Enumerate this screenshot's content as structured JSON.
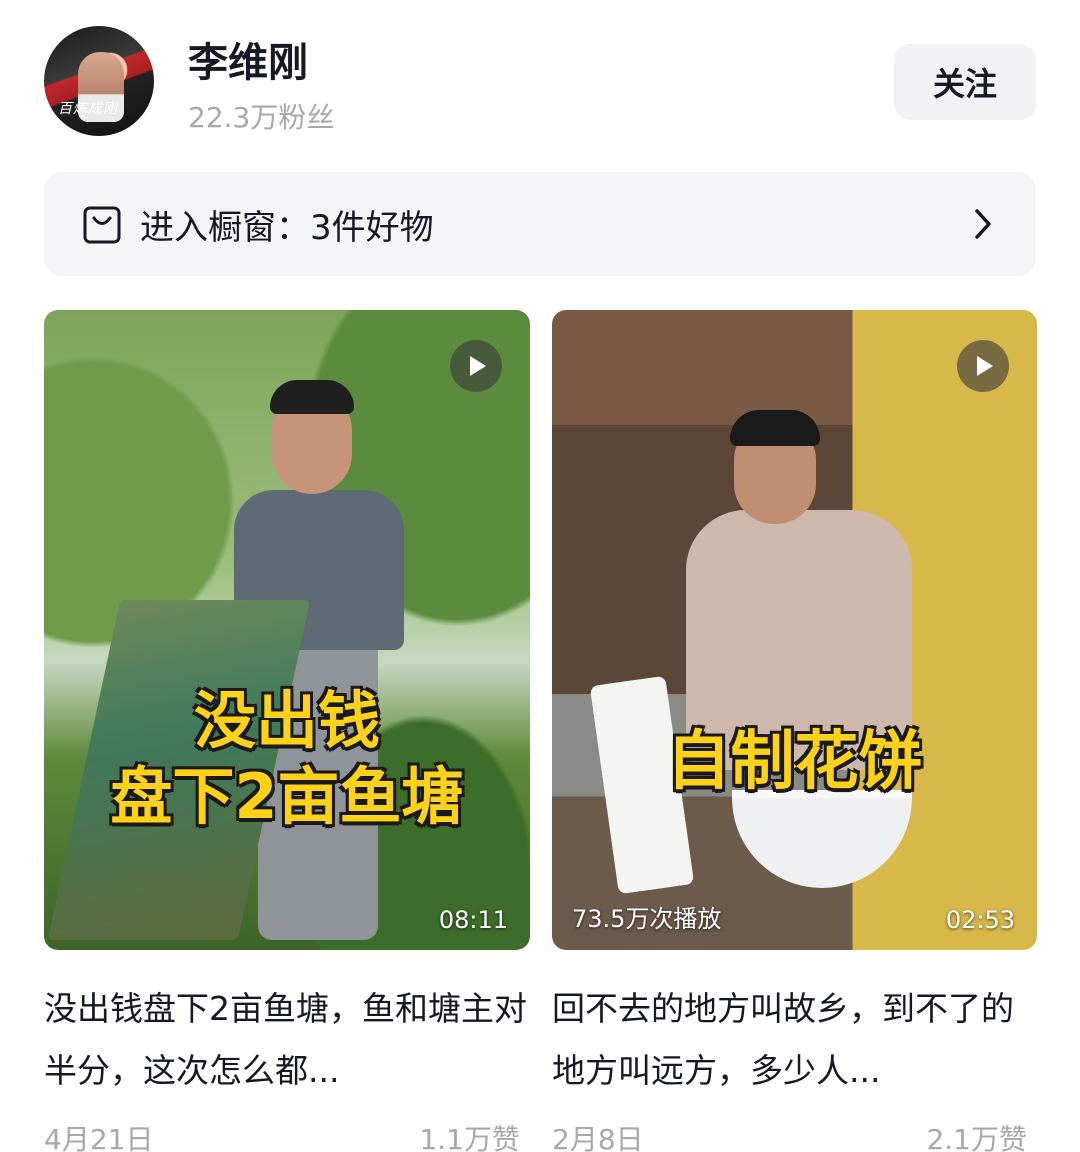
{
  "profile": {
    "name": "李维刚",
    "fans": "22.3万粉丝",
    "avatar_text": "百炼成刚",
    "follow_label": "关注"
  },
  "shop": {
    "label": "进入橱窗：3件好物",
    "icon": "shopping-bag-icon",
    "arrow_icon": "chevron-right-icon"
  },
  "videos": [
    {
      "overlay_line1": "没出钱",
      "overlay_line2": "盘下2亩鱼塘",
      "duration": "08:11",
      "plays": "",
      "caption": "没出钱盘下2亩鱼塘，鱼和塘主对半分，这次怎么都...",
      "date": "4月21日",
      "likes": "1.1万赞"
    },
    {
      "overlay_line1": "自制花饼",
      "overlay_line2": "",
      "duration": "02:53",
      "plays": "73.5万次播放",
      "caption": "回不去的地方叫故乡，到不了的地方叫远方，多少人...",
      "date": "2月8日",
      "likes": "2.1万赞"
    }
  ],
  "colors": {
    "overlay_text": "#ffd21a",
    "secondary_text": "#a7a8ac",
    "bar_bg": "#f4f5f7"
  }
}
